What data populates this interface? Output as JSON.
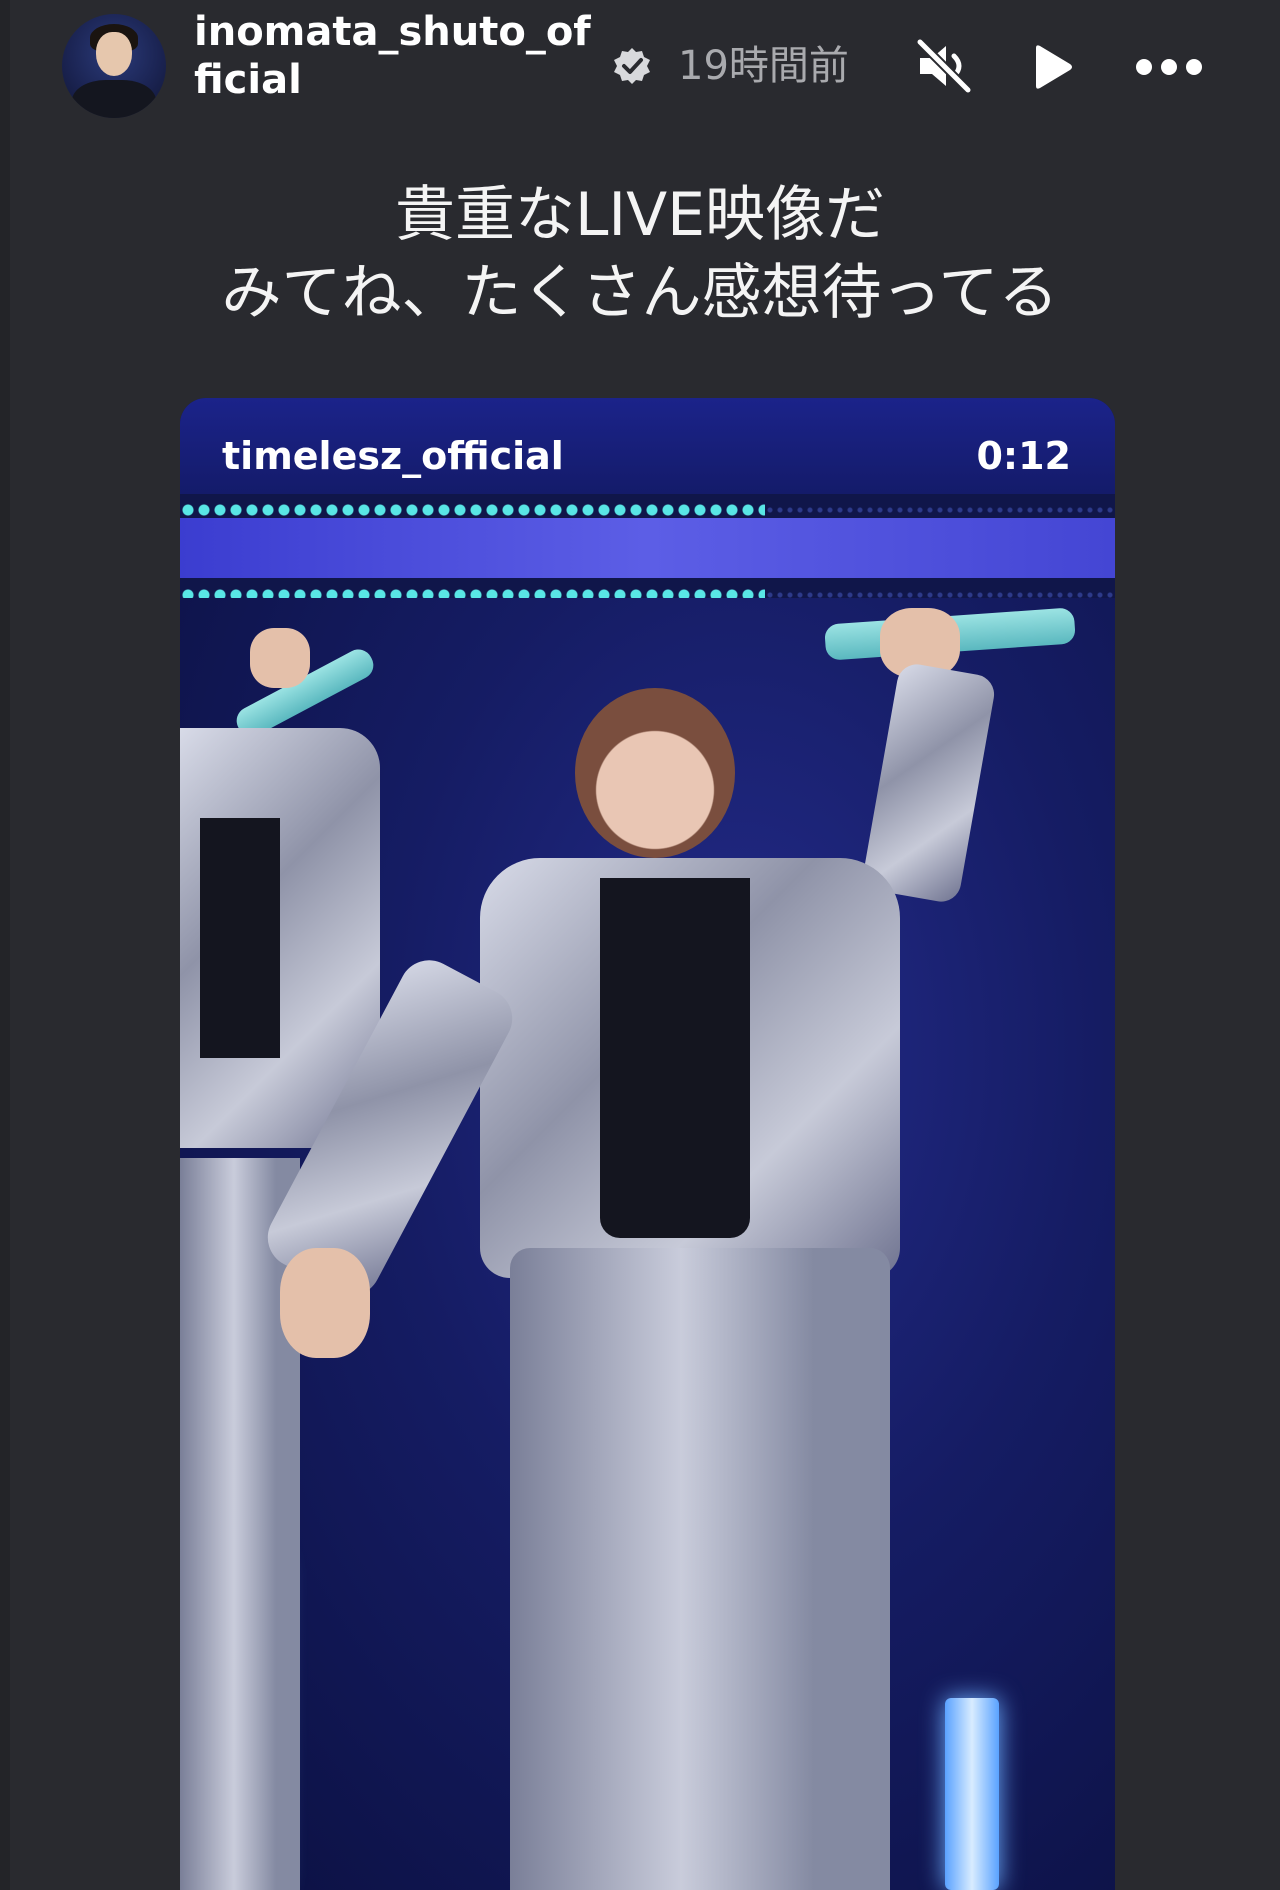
{
  "header": {
    "username": "inomata_shuto_official",
    "verified_icon": "verified-badge-icon",
    "time_ago": "19時間前",
    "controls": [
      "mute-icon",
      "play-icon",
      "more-icon"
    ]
  },
  "caption": {
    "line1": "貴重なLIVE映像だ",
    "line2": "みてね、たくさん感想待ってる"
  },
  "shared_video": {
    "username": "timelesz_official",
    "timestamp": "0:12",
    "description": "stage performance video"
  }
}
